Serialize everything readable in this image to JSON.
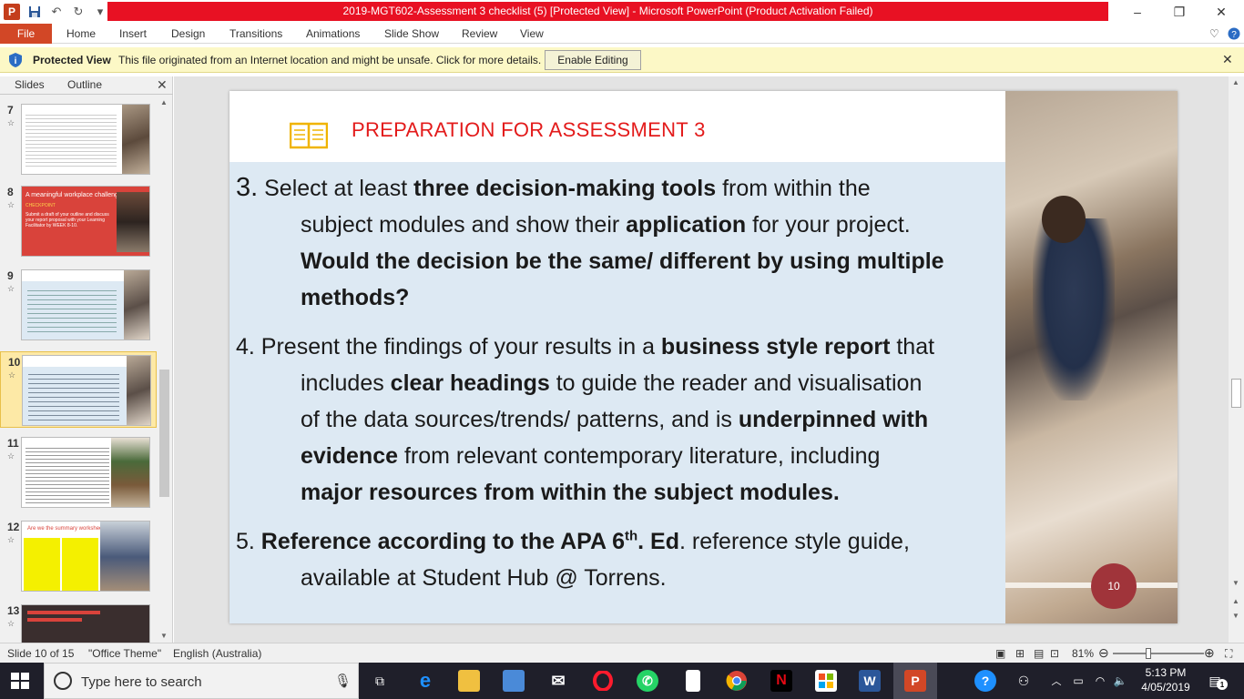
{
  "window": {
    "title": "2019-MGT602-Assessment 3 checklist (5) [Protected View]  -  Microsoft PowerPoint (Product Activation Failed)"
  },
  "ribbon": {
    "file_label": "File",
    "tabs": [
      "Home",
      "Insert",
      "Design",
      "Transitions",
      "Animations",
      "Slide Show",
      "Review",
      "View"
    ]
  },
  "protected_view": {
    "label": "Protected View",
    "message": "This file originated from an Internet location and might be unsafe. Click for more details.",
    "enable_button": "Enable Editing"
  },
  "left_pane": {
    "tab_slides": "Slides",
    "tab_outline": "Outline",
    "thumbnails": [
      {
        "num": "7",
        "star": "☆"
      },
      {
        "num": "8",
        "star": "☆",
        "heading": "A meaningful workplace challenge",
        "sub": "CHECKPOINT",
        "body": "Submit a draft of your outline and discuss your report proposal with your Learning Facilitator by WEEK 8-10."
      },
      {
        "num": "9",
        "star": "☆"
      },
      {
        "num": "10",
        "star": "☆"
      },
      {
        "num": "11",
        "star": "☆"
      },
      {
        "num": "12",
        "star": "☆",
        "heading": "Are we the summary worksheet"
      },
      {
        "num": "13",
        "star": "☆"
      }
    ]
  },
  "slide": {
    "title": "PREPARATION FOR ASSESSMENT 3",
    "page_number": "10",
    "p3": {
      "num": "3.",
      "a": " Select at least ",
      "b": "three decision-making  tools",
      "c": " from within the",
      "d": "subject modules and show their ",
      "e": "application",
      "f": " for your project.",
      "g": "Would the decision be the same/ different by using multiple",
      "h": "methods?"
    },
    "p4": {
      "a": "4. Present the findings of your results in a ",
      "b": "business style report",
      "c": " that",
      "d": "includes ",
      "e": "clear headings",
      "f": " to guide the reader and visualisation",
      "g": "of the data sources/trends/ patterns, and is ",
      "h": "underpinned with",
      "i": "evidence",
      "j": " from relevant contemporary literature, including",
      "k": "major resources from within  the subject modules."
    },
    "p5": {
      "a": "5. ",
      "b": "Reference according to the APA 6",
      "sup": "th",
      "c": ". Ed",
      "d": ". reference style guide,",
      "e": "available at Student Hub @ Torrens."
    }
  },
  "status_bar": {
    "slide_info": "Slide 10 of 15",
    "theme": "\"Office Theme\"",
    "language": "English (Australia)",
    "zoom": "81%"
  },
  "taskbar": {
    "search_placeholder": "Type here to search",
    "time": "5:13 PM",
    "date": "4/05/2019",
    "notification_count": "1"
  }
}
